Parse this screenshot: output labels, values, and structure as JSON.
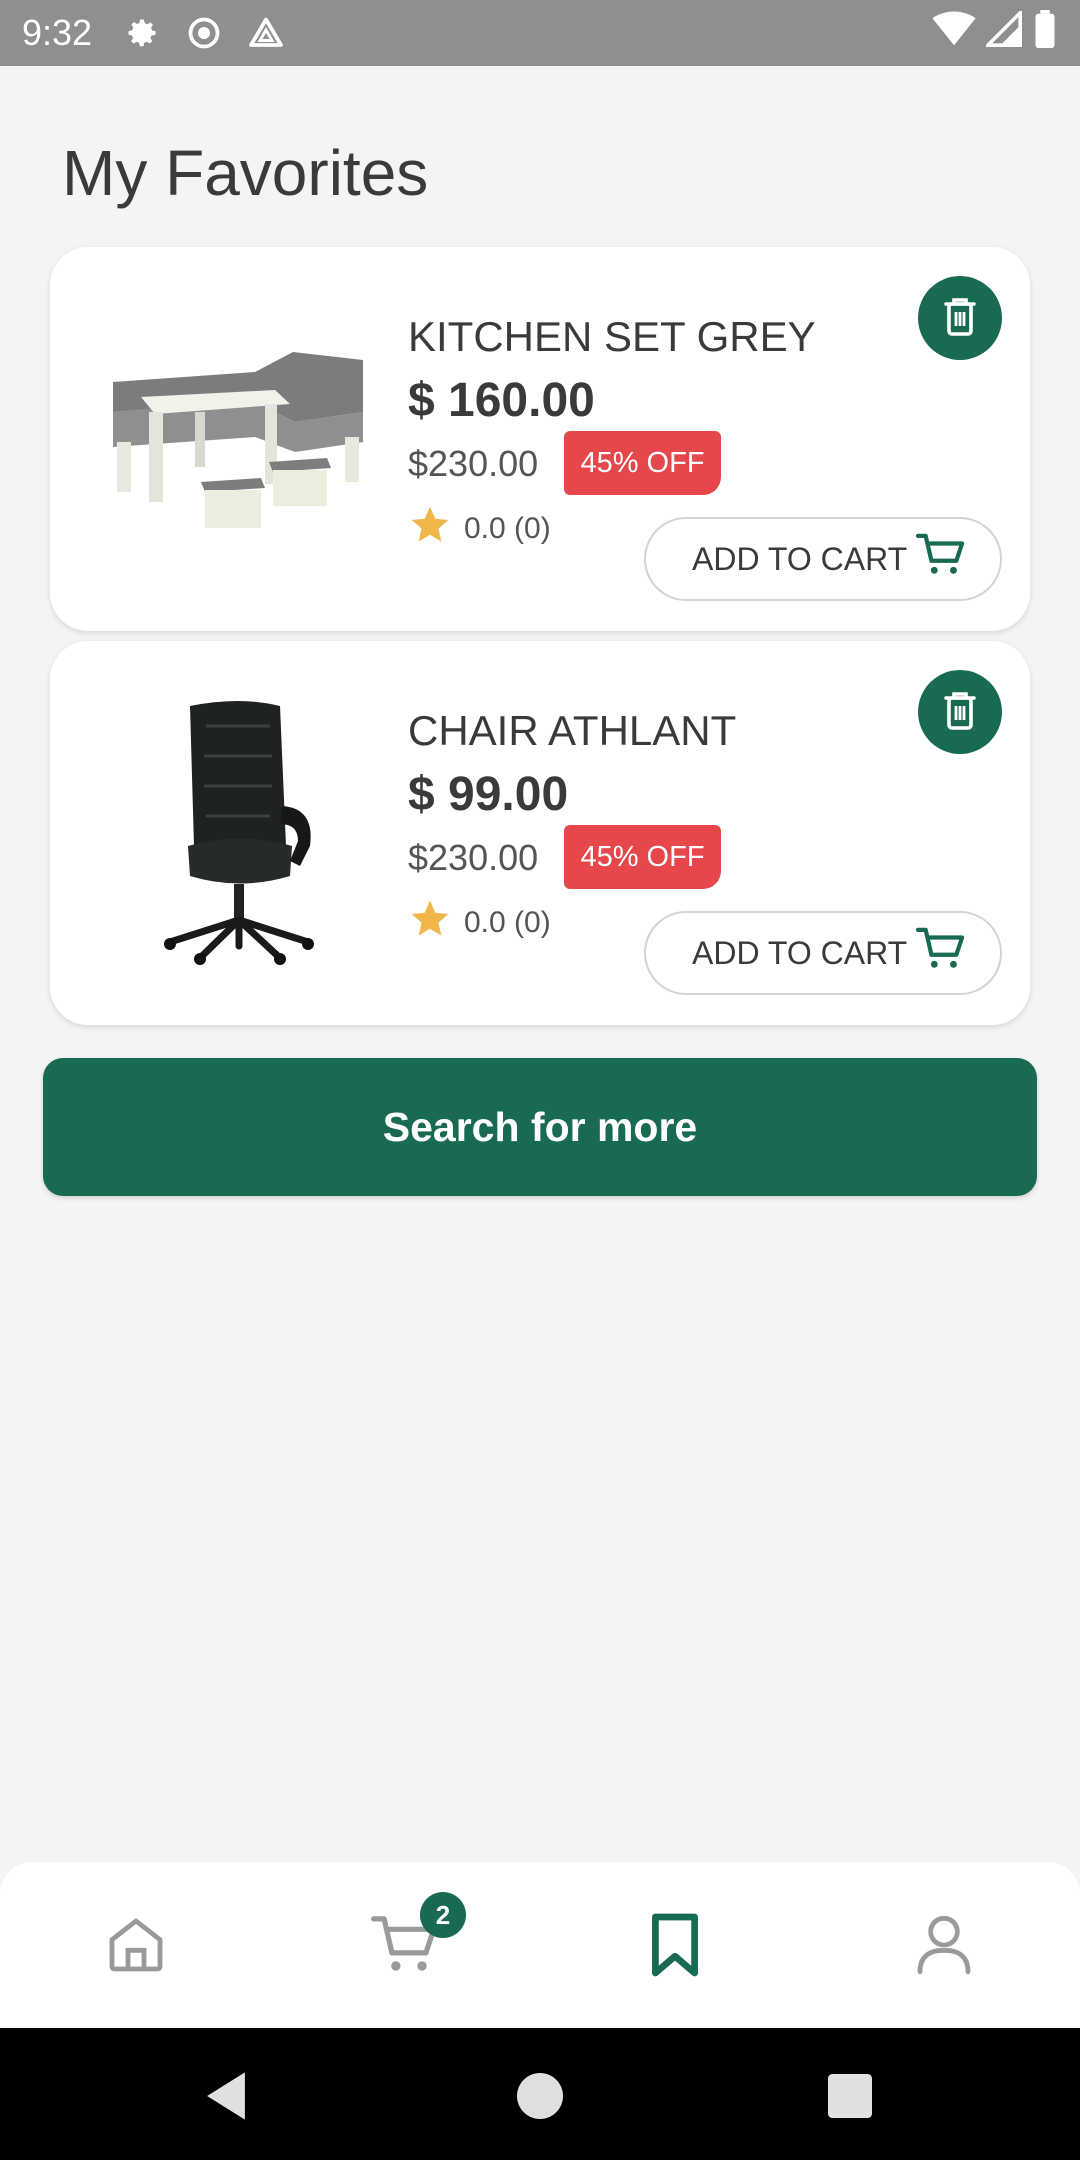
{
  "status_bar": {
    "time": "9:32",
    "icons": [
      "gear-icon",
      "record-icon",
      "drive-icon",
      "wifi-icon",
      "signal-icon",
      "battery-icon"
    ]
  },
  "page": {
    "title": "My Favorites"
  },
  "favorites": [
    {
      "name": "KITCHEN SET GREY",
      "price": "$ 160.00",
      "old_price": "$230.00",
      "discount": "45% OFF",
      "rating": "0.0 (0)",
      "add_to_cart": "ADD TO CART",
      "image": "kitchen-set-image"
    },
    {
      "name": "CHAIR ATHLANT",
      "price": "$ 99.00",
      "old_price": "$230.00",
      "discount": "45% OFF",
      "rating": "0.0 (0)",
      "add_to_cart": "ADD TO CART",
      "image": "office-chair-image"
    }
  ],
  "search_more_label": "Search for more",
  "bottom_nav": {
    "items": [
      "home-icon",
      "cart-icon",
      "bookmark-icon",
      "profile-icon"
    ],
    "active": "bookmark-icon",
    "cart_badge": "2"
  },
  "colors": {
    "primary": "#186a53",
    "discount": "#e5474b",
    "star": "#f0b64a",
    "background": "#f4f4f4"
  }
}
